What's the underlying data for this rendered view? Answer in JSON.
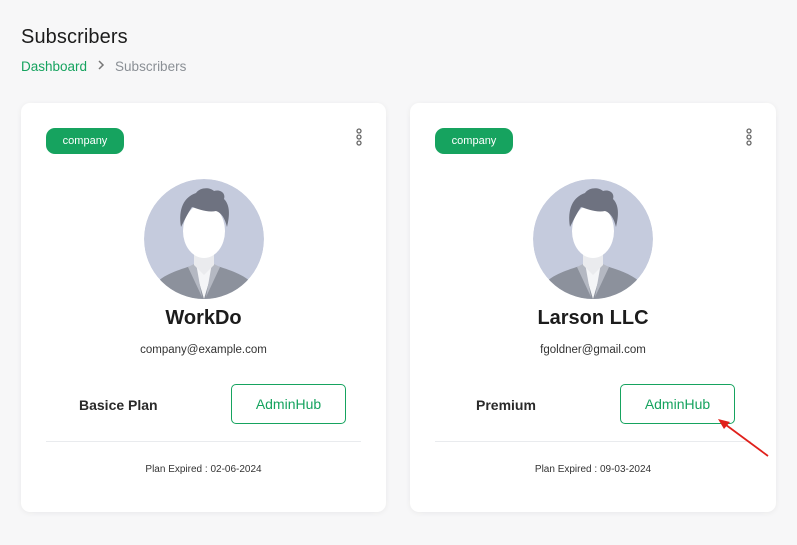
{
  "page": {
    "title": "Subscribers",
    "breadcrumb": {
      "home": "Dashboard",
      "current": "Subscribers"
    }
  },
  "cards": [
    {
      "badge": "company",
      "name": "WorkDo",
      "email": "company@example.com",
      "plan": "Basice Plan",
      "button_label": "AdminHub",
      "expired": "Plan Expired : 02-06-2024"
    },
    {
      "badge": "company",
      "name": "Larson LLC",
      "email": "fgoldner@gmail.com",
      "plan": "Premium",
      "button_label": "AdminHub",
      "expired": "Plan Expired : 09-03-2024"
    }
  ],
  "colors": {
    "accent": "#16a35f",
    "annotation_arrow": "#e0201b",
    "avatar_bg": "#c5cbdd"
  },
  "icons": {
    "kebab": "more-vertical-icon",
    "breadcrumb_separator": "chevron-right-icon",
    "avatar": "user-silhouette-icon"
  }
}
